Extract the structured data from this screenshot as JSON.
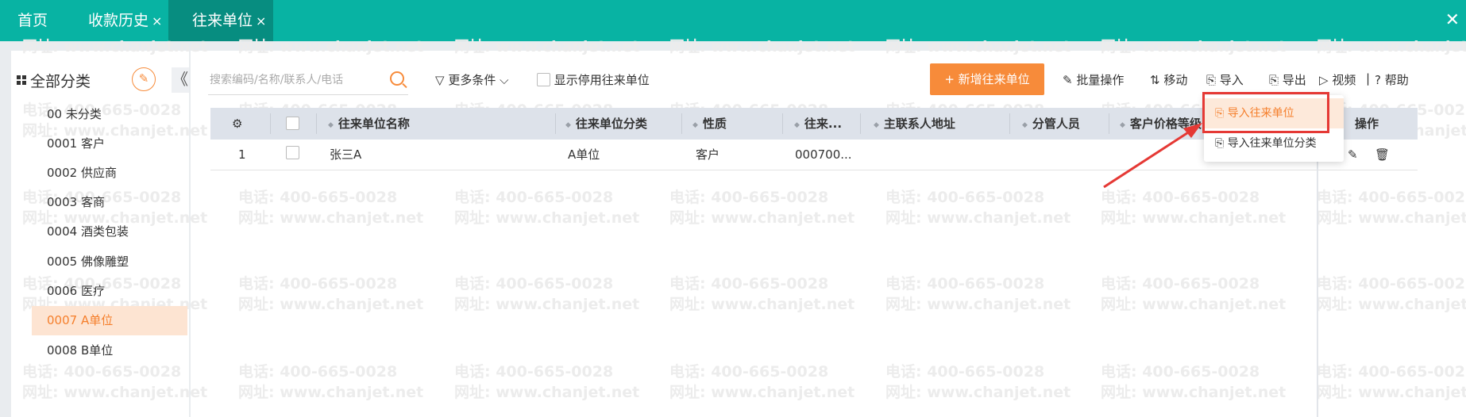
{
  "tabs": [
    {
      "label": "首页",
      "closable": false
    },
    {
      "label": "收款历史",
      "closable": true
    },
    {
      "label": "往来单位",
      "closable": true,
      "active": true
    }
  ],
  "tab_close_glyph": "×",
  "window_close_glyph": "✕",
  "watermark": {
    "phone": "电话: 400-665-0028",
    "site": "网址: www.chanjet.net"
  },
  "sidebar": {
    "title": "全部分类",
    "collapse_glyph": "《",
    "items": [
      "00 未分类",
      "0001 客户",
      "0002 供应商",
      "0003 客商",
      "0004 酒类包装",
      "0005 佛像雕塑",
      "0006 医疗",
      "0007 A单位",
      "0008 B单位"
    ],
    "selected_index": 7
  },
  "toolbar": {
    "search_placeholder": "搜索编码/名称/联系人/电话",
    "more_conditions": "更多条件",
    "show_disabled": "显示停用往来单位",
    "add_button": "+ 新增往来单位",
    "batch": "批量操作",
    "move": "移动",
    "import": "导入",
    "export": "导出",
    "video": "视频",
    "separator": "|",
    "help": "帮助"
  },
  "table": {
    "columns": [
      "往来单位名称",
      "往来单位分类",
      "性质",
      "往来...",
      "主联系人地址",
      "分管人员",
      "客户价格等级",
      "操作"
    ],
    "rows": [
      {
        "index": "1",
        "name": "张三A",
        "category": "A单位",
        "nature": "客户",
        "code": "000700..."
      }
    ]
  },
  "dropdown": {
    "items": [
      "导入往来单位",
      "导入往来单位分类"
    ],
    "highlighted_index": 0
  },
  "colors": {
    "brand": "#08b3a3",
    "accent": "#f78b3a",
    "annotation": "#e53935"
  }
}
